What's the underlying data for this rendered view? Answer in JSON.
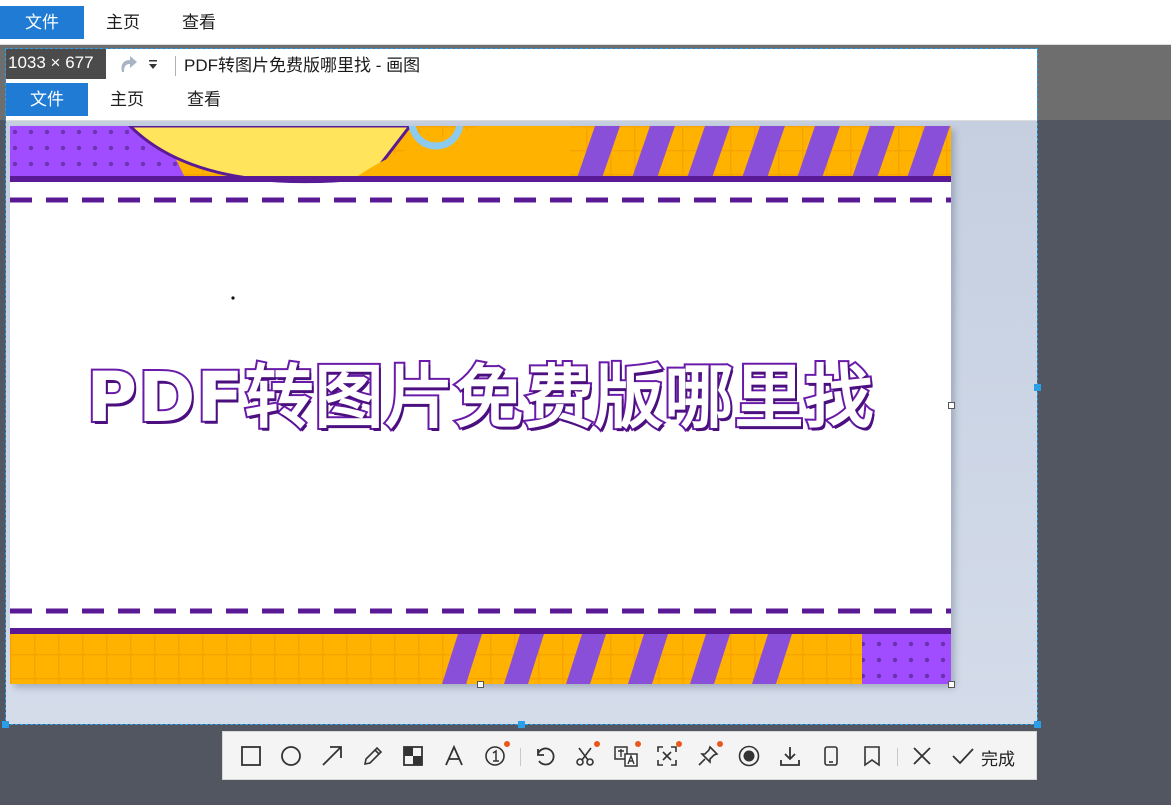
{
  "outer_window": {
    "menu": [
      "文件",
      "主页",
      "查看"
    ],
    "active_menu": "文件"
  },
  "selection": {
    "size_label": "1033 × 677",
    "window_title": "PDF转图片免费版哪里找 - 画图",
    "menu": [
      "文件",
      "主页",
      "查看"
    ],
    "image_title": "PDF转图片免费版哪里找"
  },
  "toolbar": {
    "tools": [
      {
        "name": "rectangle-tool",
        "icon": "rectangle-icon",
        "badge": false
      },
      {
        "name": "ellipse-tool",
        "icon": "circle-icon",
        "badge": false
      },
      {
        "name": "arrow-tool",
        "icon": "arrow-icon",
        "badge": false
      },
      {
        "name": "pen-tool",
        "icon": "pencil-icon",
        "badge": false
      },
      {
        "name": "mosaic-tool",
        "icon": "mosaic-icon",
        "badge": false
      },
      {
        "name": "text-tool",
        "icon": "text-icon",
        "badge": false
      },
      {
        "name": "number-tool",
        "icon": "numbered-marker-icon",
        "badge": true
      },
      {
        "name": "undo-tool",
        "icon": "undo-icon",
        "badge": false
      },
      {
        "name": "cut-tool",
        "icon": "scissors-icon",
        "badge": true
      },
      {
        "name": "translate-tool",
        "icon": "translate-icon",
        "badge": true
      },
      {
        "name": "ocr-tool",
        "icon": "ocr-icon",
        "badge": true
      },
      {
        "name": "pin-tool",
        "icon": "pin-icon",
        "badge": true
      },
      {
        "name": "record-tool",
        "icon": "record-icon",
        "badge": false
      },
      {
        "name": "download-tool",
        "icon": "download-icon",
        "badge": false
      },
      {
        "name": "phone-tool",
        "icon": "phone-icon",
        "badge": false
      },
      {
        "name": "bookmark-tool",
        "icon": "bookmark-icon",
        "badge": false
      },
      {
        "name": "close-tool",
        "icon": "close-icon",
        "badge": false
      },
      {
        "name": "done-tool",
        "icon": "check-icon",
        "badge": false
      }
    ],
    "done_label": "完成"
  },
  "colors": {
    "accent_blue": "#1f7bd3",
    "art_purple": "#6a1aa8",
    "art_orange": "#ffb300",
    "badge_orange": "#e8571e"
  }
}
